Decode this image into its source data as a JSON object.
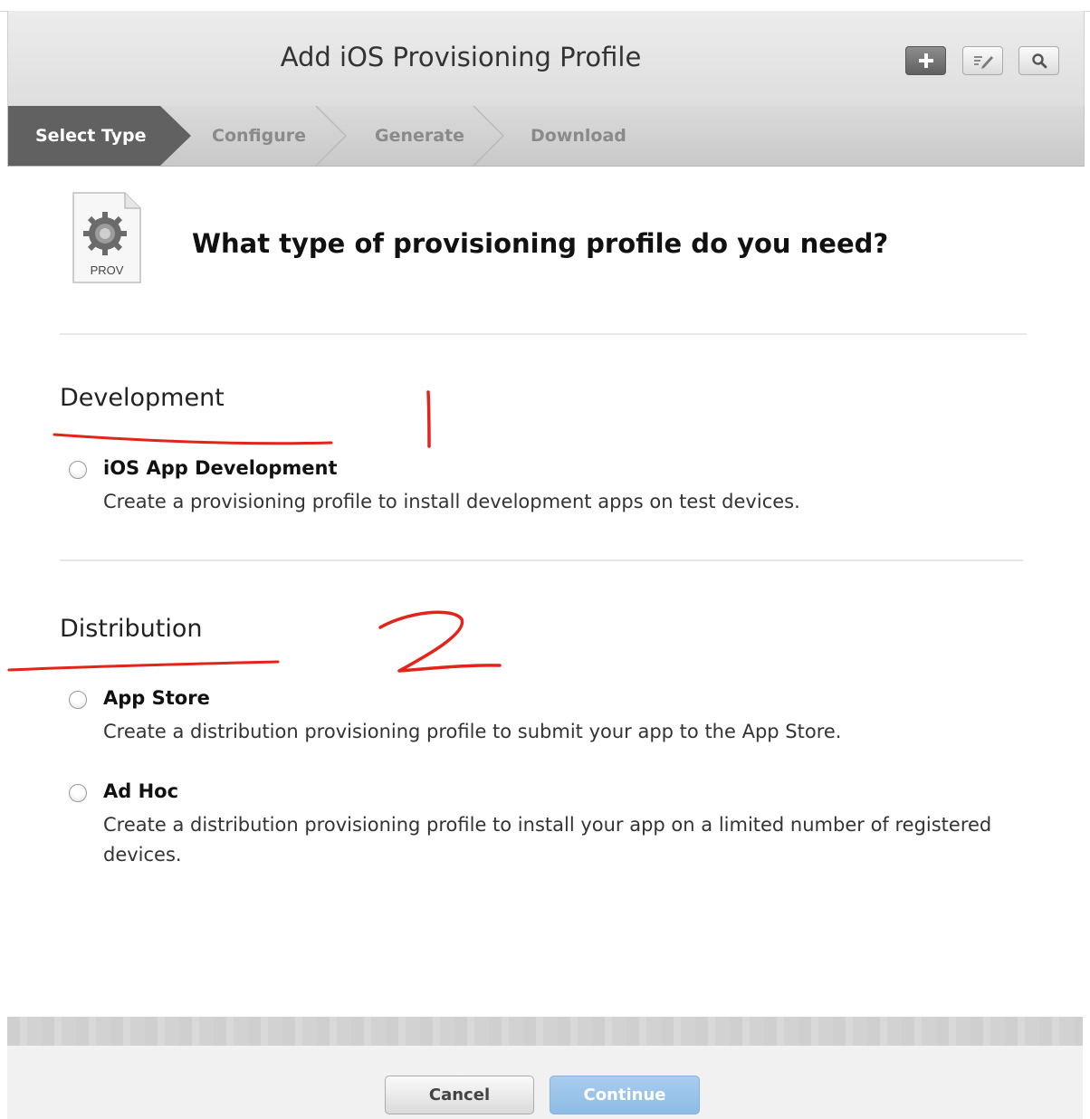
{
  "header": {
    "title": "Add iOS Provisioning Profile",
    "tools": [
      {
        "icon": "plus-icon"
      },
      {
        "icon": "edit-icon"
      },
      {
        "icon": "search-icon"
      }
    ]
  },
  "steps": {
    "items": [
      "Select Type",
      "Configure",
      "Generate",
      "Download"
    ],
    "active_index": 0
  },
  "icon": {
    "name": "prov-file-icon",
    "label": "PROV"
  },
  "question": "What type of provisioning profile do you need?",
  "sections": {
    "development": {
      "title": "Development",
      "options": [
        {
          "label": "iOS App Development",
          "description": "Create a provisioning profile to install development apps on test devices."
        }
      ]
    },
    "distribution": {
      "title": "Distribution",
      "options": [
        {
          "label": "App Store",
          "description": "Create a distribution provisioning profile to submit your app to the App Store."
        },
        {
          "label": "Ad Hoc",
          "description": "Create a distribution provisioning profile to install your app on a limited number of registered devices."
        }
      ]
    }
  },
  "footer": {
    "cancel_label": "Cancel",
    "continue_label": "Continue"
  },
  "annotation": {
    "color": "#e3241b",
    "marks": [
      "1",
      "2"
    ]
  },
  "colors": {
    "active_step": "#616161",
    "continue_button": "#8dbbe6"
  }
}
